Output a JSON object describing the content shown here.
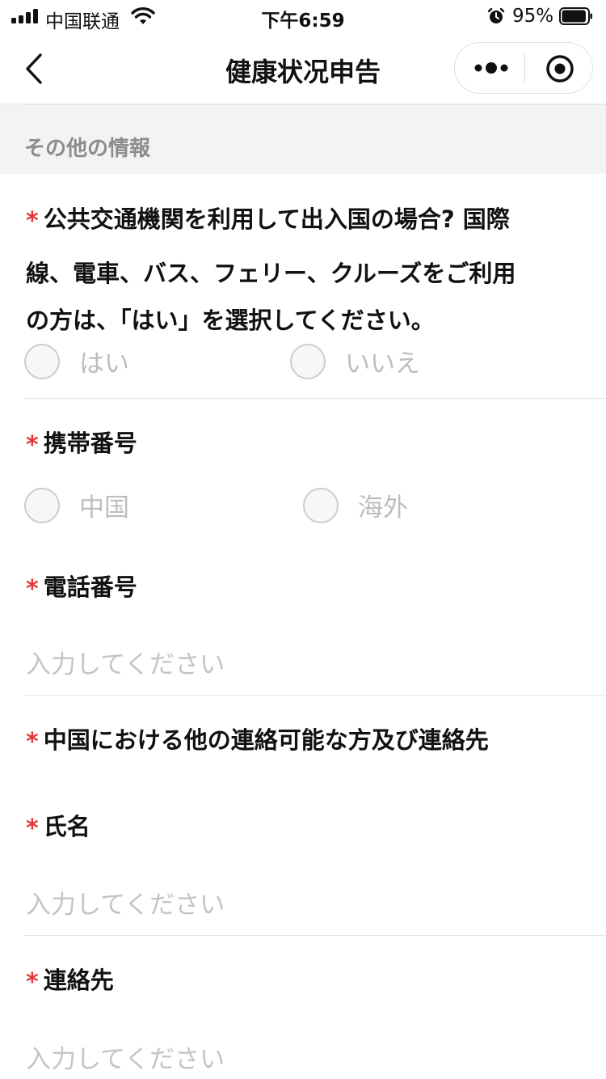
{
  "status": {
    "carrier": "中国联通",
    "time": "下午6:59",
    "battery": "95%",
    "battery_level": 0.95
  },
  "nav": {
    "title": "健康状况申告",
    "back_icon": "chevron-left-icon",
    "more_icon": "more-dots-icon",
    "close_icon": "record-target-icon"
  },
  "section": {
    "title": "その他の情報"
  },
  "form": {
    "required_mark": "*",
    "transport": {
      "line1": "公共交通機関を利用して出入国の場合? 国際",
      "line2": "線、電車、バス、フェリー、クルーズをご利用",
      "line3": "の方は、「はい」を選択してください。",
      "option_yes": "はい",
      "option_no": "いいえ"
    },
    "mobile": {
      "label": "携帯番号",
      "option_china": "中国",
      "option_overseas": "海外"
    },
    "phone": {
      "label": "電話番号",
      "placeholder": "入力してください"
    },
    "contact_group": {
      "label": "中国における他の連絡可能な方及び連絡先"
    },
    "name": {
      "label": "氏名",
      "placeholder": "入力してください"
    },
    "contact": {
      "label": "連絡先",
      "placeholder": "入力してください"
    }
  },
  "colors": {
    "required": "#e4393c",
    "placeholder": "#c4c4c4",
    "section_bg": "#f3f3f3"
  }
}
